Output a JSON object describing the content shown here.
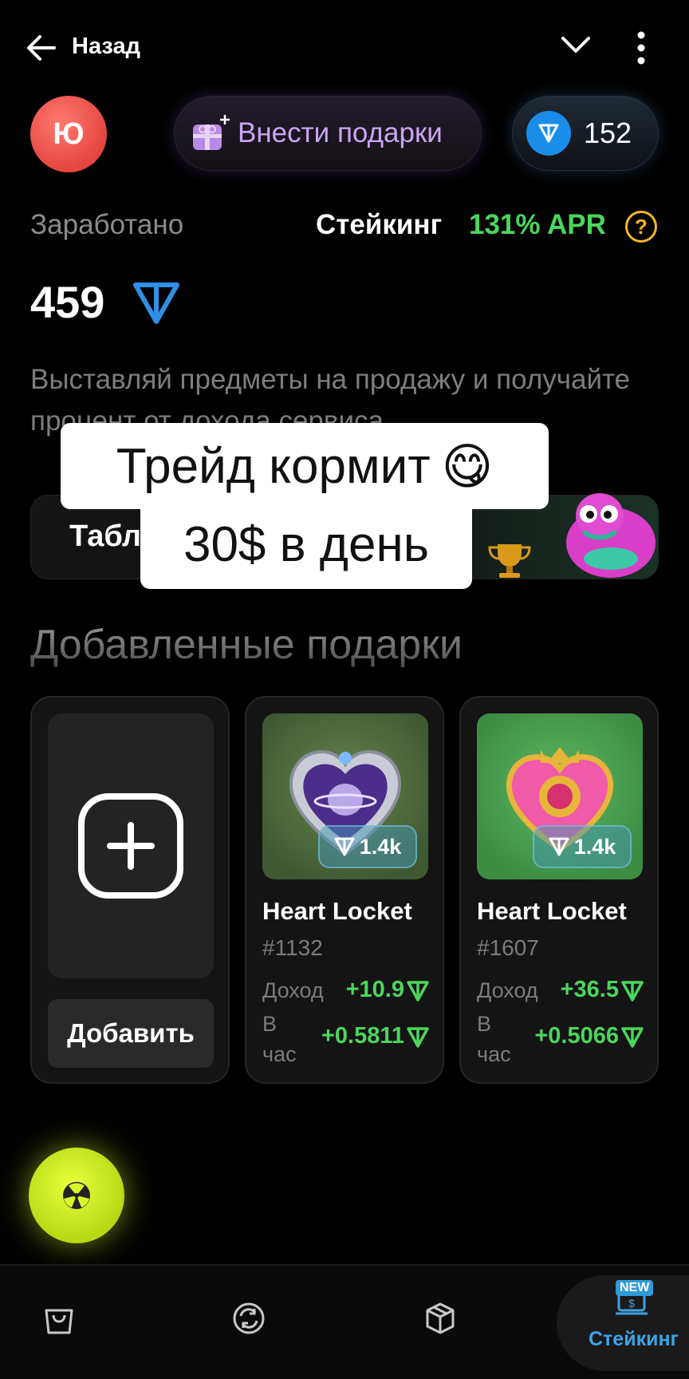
{
  "header": {
    "back_label": "Назад",
    "avatar_letter": "Ю",
    "deposit_label": "Внести подарки",
    "balance": "152"
  },
  "stats": {
    "earned_label": "Заработано",
    "staking_label": "Стейкинг",
    "apr": "131% APR",
    "help": "?",
    "earned_value": "459"
  },
  "description": "Выставляй предметы на продажу и получайте процент от дохода сервиса",
  "leaderboard": {
    "title_visible": "Табл"
  },
  "overlay": {
    "line1": "Трейд кормит",
    "emoji": "😋",
    "line2": "30$ в день"
  },
  "section_title": "Добавленные подарки",
  "add_card": {
    "button_label": "Добавить"
  },
  "gifts": [
    {
      "name": "Heart Locket",
      "number": "#1132",
      "price": "1.4k",
      "income_label": "Доход",
      "income": "+10.9",
      "per_hour_label": "В час",
      "per_hour": "+0.5811"
    },
    {
      "name": "Heart Locket",
      "number": "#1607",
      "price": "1.4k",
      "income_label": "Доход",
      "income": "+36.5",
      "per_hour_label": "В час",
      "per_hour": "+0.5066"
    }
  ],
  "nav": {
    "items": [
      "shop-icon",
      "trade-icon",
      "inventory-icon",
      "staking-icon"
    ],
    "new_badge": "NEW",
    "active_label": "Стейкинг"
  },
  "colors": {
    "accent_green": "#4cd55c",
    "ton_blue": "#1a8dea",
    "fab_yellow": "#d8f52a",
    "purple": "#caa5f5",
    "help_yellow": "#f5b625"
  }
}
